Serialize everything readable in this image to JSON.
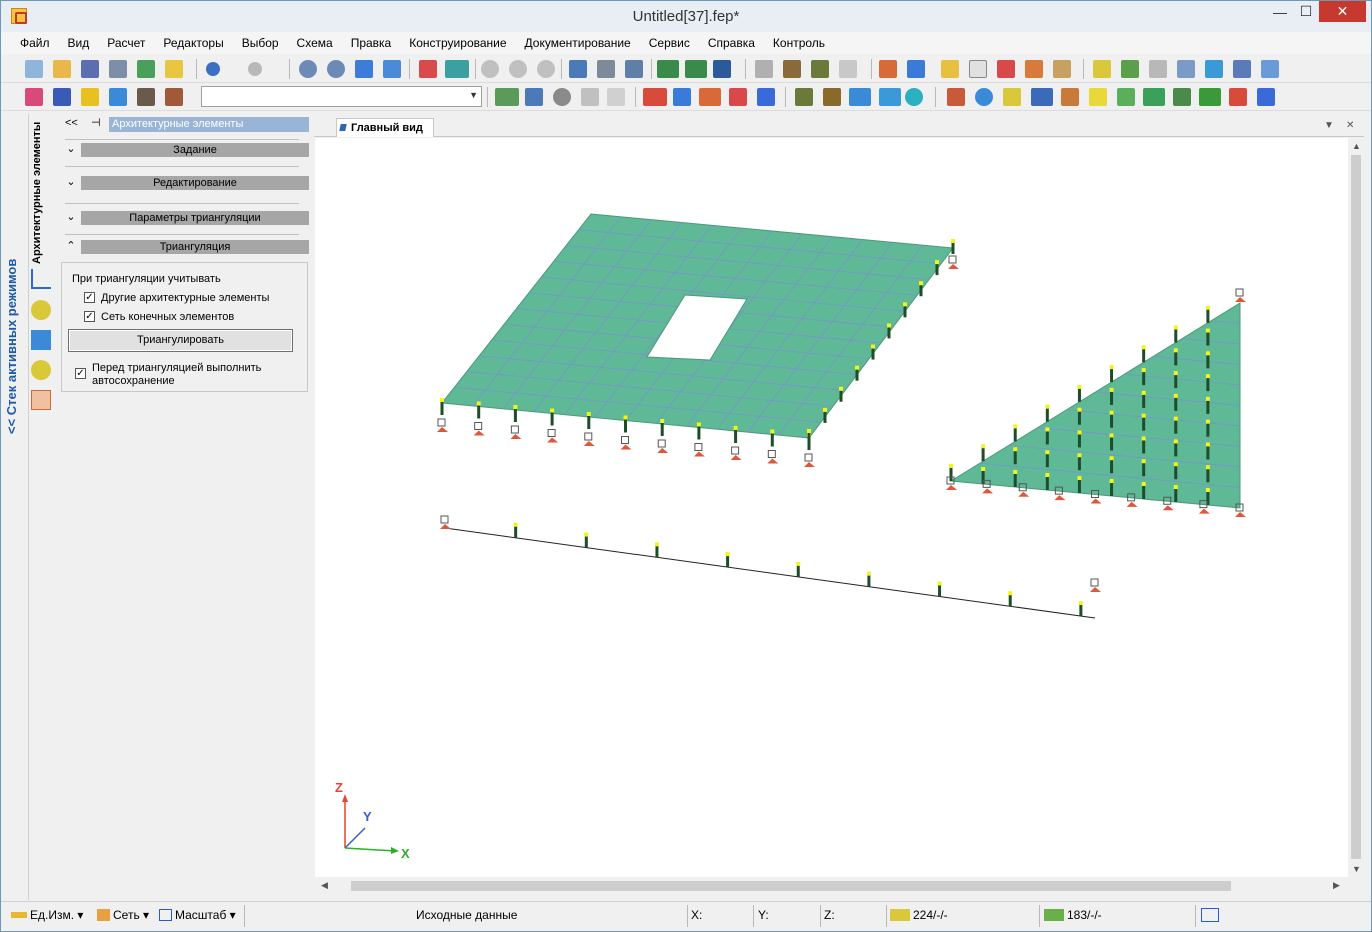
{
  "window": {
    "title": "Untitled[37].fep*",
    "min": "—",
    "max": "☐",
    "close": "✕"
  },
  "menu": [
    {
      "label": "Файл"
    },
    {
      "label": "Вид"
    },
    {
      "label": "Расчет"
    },
    {
      "label": "Редакторы"
    },
    {
      "label": "Выбор"
    },
    {
      "label": "Схема"
    },
    {
      "label": "Правка"
    },
    {
      "label": "Конструирование"
    },
    {
      "label": "Документирование"
    },
    {
      "label": "Сервис"
    },
    {
      "label": "Справка"
    },
    {
      "label": "Контроль"
    }
  ],
  "toolbar": {
    "combo_value": ""
  },
  "mode_strip": {
    "label": "<< Стек активных режимов"
  },
  "panel": {
    "tab_label": "Архитектурные элементы",
    "back": "<<",
    "pin": "⊣",
    "title": "Архитектурные элементы",
    "sections": [
      {
        "label": "Задание",
        "chevron": "⌄"
      },
      {
        "label": "Редактирование",
        "chevron": "⌄"
      },
      {
        "label": "Параметры триангуляции",
        "chevron": "⌄"
      },
      {
        "label": "Триангуляция",
        "chevron": "⌃"
      }
    ],
    "triangulation": {
      "consider_label": "При триангуляции учитывать",
      "option_arch": "Другие архитектурные элементы",
      "option_arch_checked": true,
      "option_mesh": "Сеть конечных элементов",
      "option_mesh_checked": true,
      "button": "Триангулировать",
      "autosave": "Перед триангуляцией выполнить автосохранение",
      "autosave_checked": true,
      "check_mark": "✓"
    }
  },
  "view": {
    "tab": "Главный вид",
    "axes": {
      "x": "X",
      "y": "Y",
      "z": "Z"
    },
    "colors": {
      "plate": "#5fb896",
      "grid": "#7a8fd6",
      "post": "#1d4d2a",
      "post_tip": "#f2f51a"
    }
  },
  "status": {
    "units": "Ед.Изм.",
    "mesh": "Сеть",
    "scale": "Масштаб",
    "mode": "Исходные данные",
    "x": "X:",
    "y": "Y:",
    "z": "Z:",
    "nodes": "224/-/-",
    "elements": "183/-/-"
  }
}
